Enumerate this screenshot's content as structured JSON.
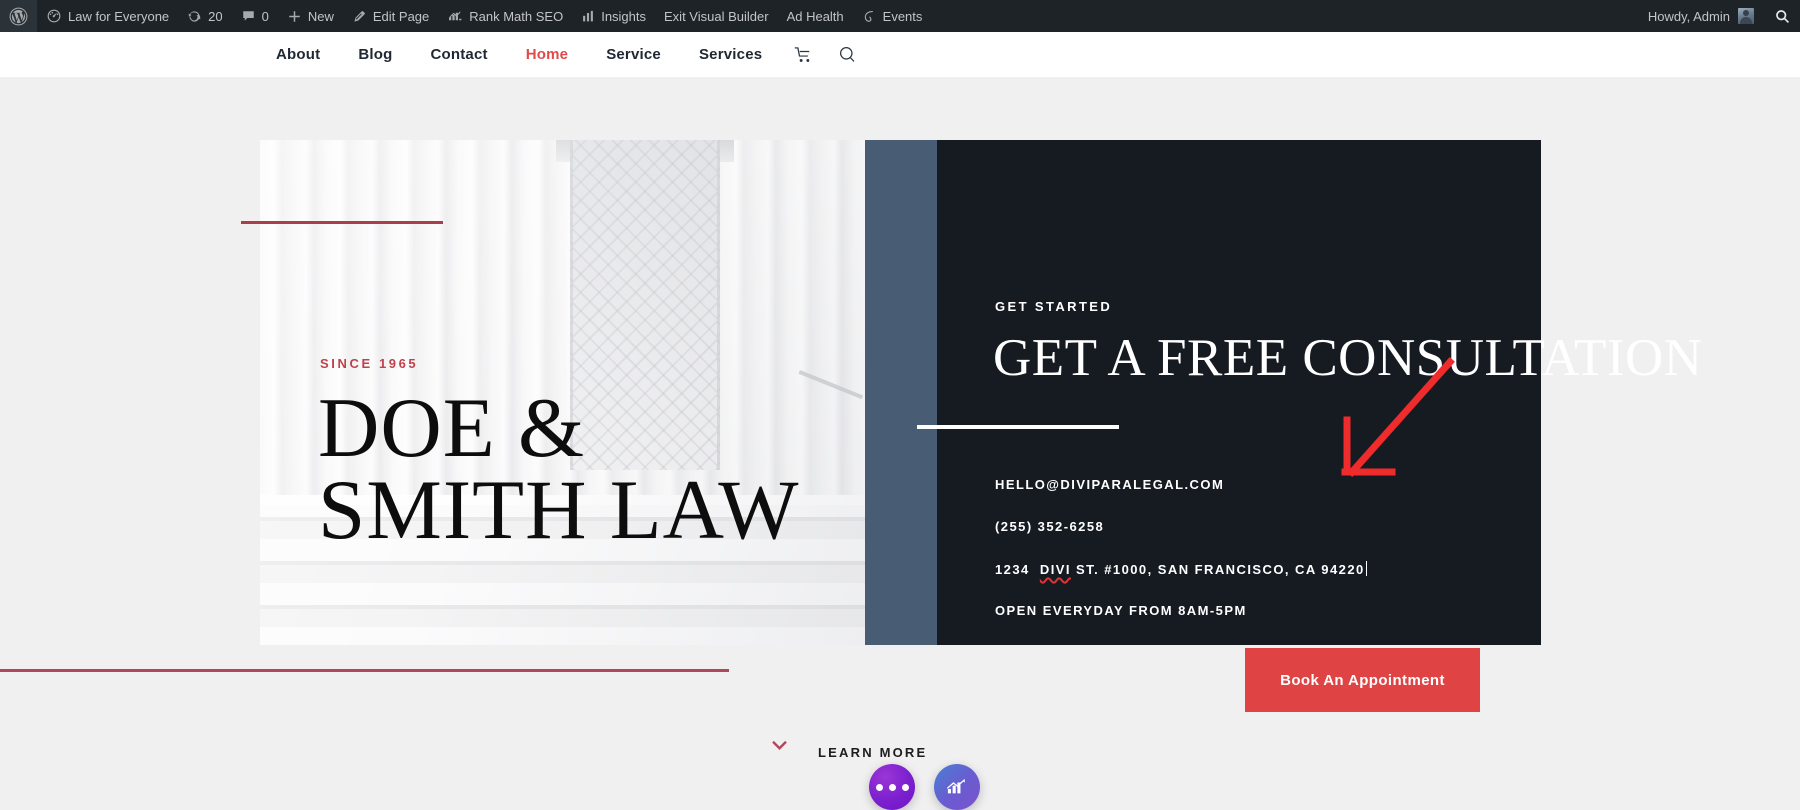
{
  "adminbar": {
    "logo_icon": "wordpress-icon",
    "items": [
      {
        "label": "Law for Everyone",
        "icon": "dashboard-speedometer-icon"
      },
      {
        "label": "20",
        "icon": "updates-refresh-icon"
      },
      {
        "label": "0",
        "icon": "comment-bubble-icon"
      },
      {
        "label": "New",
        "icon": "plus-icon"
      },
      {
        "label": "Edit Page",
        "icon": "pencil-icon"
      },
      {
        "label": "Rank Math SEO",
        "icon": "rankmath-bars-icon"
      },
      {
        "label": "Insights",
        "icon": "bar-chart-icon"
      },
      {
        "label": "Exit Visual Builder",
        "icon": ""
      },
      {
        "label": "Ad Health",
        "icon": ""
      },
      {
        "label": "Events",
        "icon": "leaf-icon"
      }
    ],
    "howdy": "Howdy, Admin",
    "avatar_alt": "admin-avatar",
    "search_icon": "search-icon"
  },
  "sitenav": {
    "links": [
      {
        "label": "About",
        "active": false
      },
      {
        "label": "Blog",
        "active": false
      },
      {
        "label": "Contact",
        "active": false
      },
      {
        "label": "Home",
        "active": true
      },
      {
        "label": "Service",
        "active": false
      },
      {
        "label": "Services",
        "active": false
      }
    ],
    "cart_icon": "shopping-cart-icon",
    "search_icon": "search-icon",
    "active_color": "#e04a4a"
  },
  "hero": {
    "left": {
      "eyebrow": "SINCE 1965",
      "eyebrow_color": "#c0414a",
      "title": "DOE & SMITH LAW",
      "rule_color": "#a93f4d"
    },
    "right": {
      "eyebrow": "GET STARTED",
      "heading": "GET A FREE CONSULTATION",
      "email": "HELLO@DIVIPARALEGAL.COM",
      "phone": "(255) 352-6258",
      "address_prefix": "1234",
      "address_misspelled": "DIVI",
      "address_rest": " ST. #1000, SAN FRANCISCO, CA 94220",
      "hours": "OPEN EVERYDAY FROM 8AM-5PM",
      "cta_label": "Book An Appointment",
      "cta_color": "#df4343",
      "panel_color": "#161b22",
      "accent_strip_color": "#485d73"
    }
  },
  "footer_area": {
    "learn_more": "LEARN MORE",
    "chevron_icon": "chevron-down-icon",
    "rule_color": "#b0475a",
    "fab_divi": "divi-menu-icon",
    "fab_rank": "rankmath-icon"
  },
  "annotation": {
    "arrow_color": "#ef2b2b",
    "arrow_name": "red-annotation-arrow"
  }
}
